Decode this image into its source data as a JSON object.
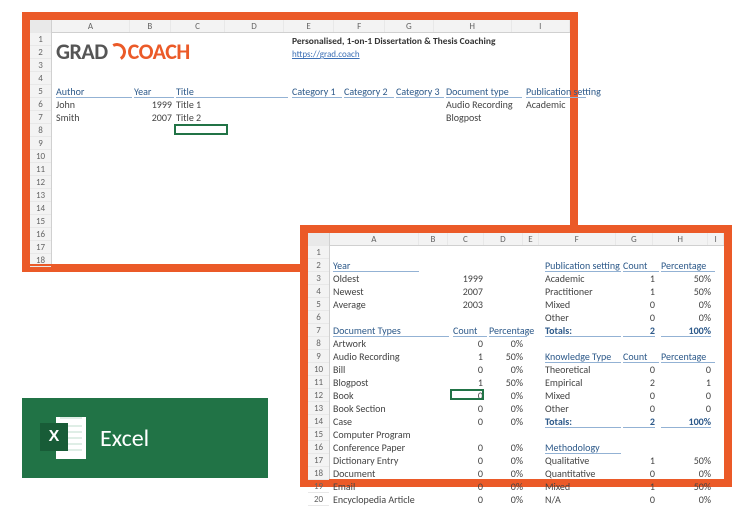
{
  "excel_label": "Excel",
  "top": {
    "cols": [
      "A",
      "B",
      "C",
      "D",
      "E",
      "F",
      "G",
      "H",
      "I"
    ],
    "row_first": 1,
    "row_last": 18,
    "logo_grad": "GRAD",
    "logo_coach": "COACH",
    "tagline": "Personalised, 1-on-1 Dissertation & Thesis Coaching",
    "url": "https://grad.coach",
    "headers": {
      "author": "Author",
      "year": "Year",
      "title": "Title",
      "cat1": "Category 1",
      "cat2": "Category 2",
      "cat3": "Category 3",
      "doctype": "Document type",
      "pubset": "Publication setting"
    },
    "rows": [
      {
        "author": "John",
        "year": "1999",
        "title": "Title 1",
        "doctype": "Audio Recording",
        "pubset": "Academic"
      },
      {
        "author": "Smith",
        "year": "2007",
        "title": "Title 2",
        "doctype": "Blogpost",
        "pubset": ""
      }
    ]
  },
  "bottom": {
    "cols": [
      "A",
      "B",
      "C",
      "D",
      "E",
      "F",
      "G",
      "H",
      "I"
    ],
    "row_first": 1,
    "row_last": 20,
    "year_hdr": "Year",
    "year_rows": [
      [
        "Oldest",
        "1999"
      ],
      [
        "Newest",
        "2007"
      ],
      [
        "Average",
        "2003"
      ]
    ],
    "pubset_hdr": "Publication setting",
    "count_hdr": "Count",
    "pct_hdr": "Percentage",
    "pubset_rows": [
      [
        "Academic",
        "1",
        "50%"
      ],
      [
        "Practitioner",
        "1",
        "50%"
      ],
      [
        "Mixed",
        "0",
        "0%"
      ],
      [
        "Other",
        "0",
        "0%"
      ]
    ],
    "totals_label": "Totals:",
    "pubset_totals": [
      "2",
      "100%"
    ],
    "doctypes_hdr": "Document Types",
    "doctypes": [
      [
        "Artwork",
        "0",
        "0%"
      ],
      [
        "Audio Recording",
        "1",
        "50%"
      ],
      [
        "Bill",
        "0",
        "0%"
      ],
      [
        "Blogpost",
        "1",
        "50%"
      ],
      [
        "Book",
        "0",
        "0%"
      ],
      [
        "Book Section",
        "0",
        "0%"
      ],
      [
        "Case",
        "0",
        "0%"
      ],
      [
        "Computer Program",
        "",
        ""
      ],
      [
        "Conference Paper",
        "0",
        "0%"
      ],
      [
        "Dictionary Entry",
        "0",
        "0%"
      ],
      [
        "Document",
        "0",
        "0%"
      ],
      [
        "Email",
        "0",
        "0%"
      ],
      [
        "Encyclopedia Article",
        "0",
        "0%"
      ]
    ],
    "knowtype_hdr": "Knowledge Type",
    "knowtype_rows": [
      [
        "Theoretical",
        "0",
        "0"
      ],
      [
        "Empirical",
        "2",
        "1"
      ],
      [
        "Mixed",
        "0",
        "0"
      ],
      [
        "Other",
        "0",
        "0"
      ]
    ],
    "knowtype_totals": [
      "2",
      "100%"
    ],
    "methodology_hdr": "Methodology",
    "methodology_rows": [
      [
        "Qualitative",
        "1",
        "50%"
      ],
      [
        "Quantitative",
        "0",
        "0%"
      ],
      [
        "Mixed",
        "1",
        "50%"
      ],
      [
        "N/A",
        "0",
        "0%"
      ]
    ]
  }
}
